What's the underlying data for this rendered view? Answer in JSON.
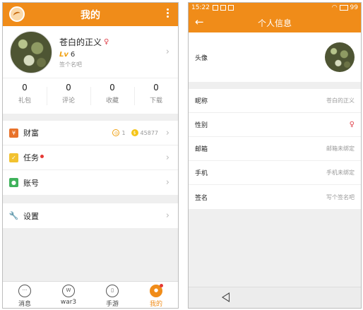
{
  "left": {
    "header": {
      "title": "我的",
      "logo_icon": "app-logo-icon",
      "menu_icon": "more-vertical-icon"
    },
    "profile": {
      "name": "苍白的正义",
      "gender_icon": "female-icon",
      "level_prefix": "Lv",
      "level": "6",
      "signature": "签个名吧"
    },
    "stats": [
      {
        "num": "0",
        "label": "礼包"
      },
      {
        "num": "0",
        "label": "评论"
      },
      {
        "num": "0",
        "label": "收藏"
      },
      {
        "num": "0",
        "label": "下载"
      }
    ],
    "menu": [
      {
        "label": "财富",
        "icon": "wallet-icon",
        "coin1": "1",
        "coin2": "45877"
      },
      {
        "label": "任务",
        "icon": "task-icon",
        "badge": true
      },
      {
        "label": "账号",
        "icon": "account-icon"
      }
    ],
    "settings": {
      "label": "设置",
      "icon": "wrench-icon"
    },
    "tabs": [
      {
        "label": "消息",
        "icon": "message-icon"
      },
      {
        "label": "war3",
        "icon": "war3-icon"
      },
      {
        "label": "手游",
        "icon": "gamepad-icon"
      },
      {
        "label": "我的",
        "icon": "profile-icon",
        "active": true
      }
    ]
  },
  "right": {
    "status": {
      "time": "15:22",
      "battery": "99"
    },
    "header": {
      "title": "个人信息"
    },
    "avatar_label": "头像",
    "rows": [
      {
        "label": "昵称",
        "value": "苍白的正义"
      },
      {
        "label": "性别",
        "value": ""
      },
      {
        "label": "邮箱",
        "value": "邮箱未绑定"
      },
      {
        "label": "手机",
        "value": "手机未绑定"
      },
      {
        "label": "签名",
        "value": "写个签名吧"
      }
    ]
  },
  "colors": {
    "accent": "#f08c19",
    "badge": "#e53935"
  }
}
